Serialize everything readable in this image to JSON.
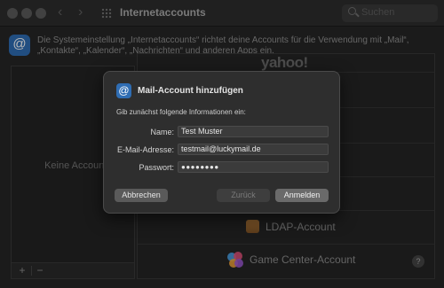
{
  "window": {
    "title": "Internetaccounts",
    "search_placeholder": "Suchen"
  },
  "info": {
    "text": "Die Systemeinstellung „Internetaccounts“ richtet deine Accounts für die Verwendung mit „Mail“, „Kontakte“, „Kalender“, „Nachrichten“ und anderen Apps ein."
  },
  "sidebar": {
    "empty_text": "Keine Accounts",
    "add_label": "+",
    "remove_label": "−"
  },
  "providers": {
    "yahoo": "yahoo!",
    "ldap": "LDAP-Account",
    "game_center": "Game Center-Account",
    "help": "?"
  },
  "dialog": {
    "title": "Mail-Account hinzufügen",
    "subtitle": "Gib zunächst folgende Informationen ein:",
    "name_label": "Name:",
    "name_value": "Test Muster",
    "email_label": "E-Mail-Adresse:",
    "email_value": "testmail@luckymail.de",
    "password_label": "Passwort:",
    "password_value": "●●●●●●●●",
    "cancel_label": "Abbrechen",
    "back_label": "Zurück",
    "login_label": "Anmelden"
  },
  "colors": {
    "accent": "#2f6db3",
    "window_bg": "#262626",
    "dialog_bg": "#2e2e2e"
  },
  "icons": {
    "at": "@",
    "back": "‹",
    "forward": "›"
  }
}
